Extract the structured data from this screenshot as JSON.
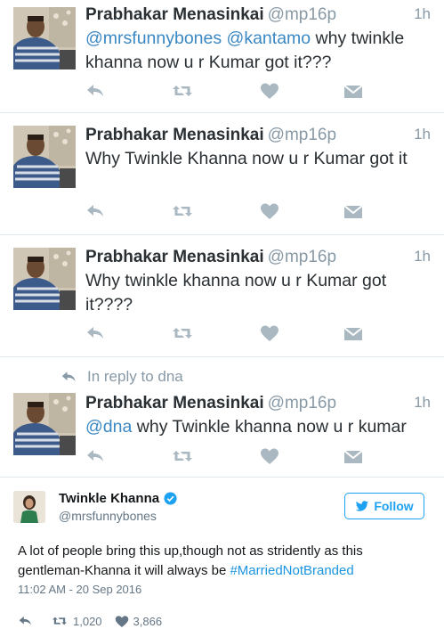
{
  "tweets": [
    {
      "name": "Prabhakar Menasinkai",
      "handle": "@mp16p",
      "time": "1h",
      "mention1": "@mrsfunnybones",
      "mention2": "@kantamo",
      "text_rest": " why twinkle khanna now u r Kumar got it???"
    },
    {
      "name": "Prabhakar Menasinkai",
      "handle": "@mp16p",
      "time": "1h",
      "text": "Why Twinkle Khanna now u r Kumar got it"
    },
    {
      "name": "Prabhakar Menasinkai",
      "handle": "@mp16p",
      "time": "1h",
      "text": "Why twinkle khanna now u r Kumar got it????"
    },
    {
      "reply_context": "In reply to dna",
      "name": "Prabhakar Menasinkai",
      "handle": "@mp16p",
      "time": "1h",
      "mention1": "@dna",
      "text_rest": " why Twinkle khanna now u r kumar"
    }
  ],
  "featured": {
    "name": "Twinkle Khanna",
    "handle": "@mrsfunnybones",
    "verified": true,
    "follow_label": "Follow",
    "text": "A lot of people bring this up,though not as stridently as this gentleman-Khanna it will always be ",
    "hashtag": "#MarriedNotBranded",
    "timestamp": "11:02 AM - 20 Sep 2016",
    "retweets": "1,020",
    "likes": "3,866"
  },
  "icons": {
    "reply": "reply-icon",
    "retweet": "retweet-icon",
    "like": "heart-icon",
    "dm": "direct-message-icon"
  },
  "colors": {
    "icon_gray": "#aab8c2",
    "link_blue": "#3b88c3",
    "follow_blue": "#1da1f2"
  }
}
